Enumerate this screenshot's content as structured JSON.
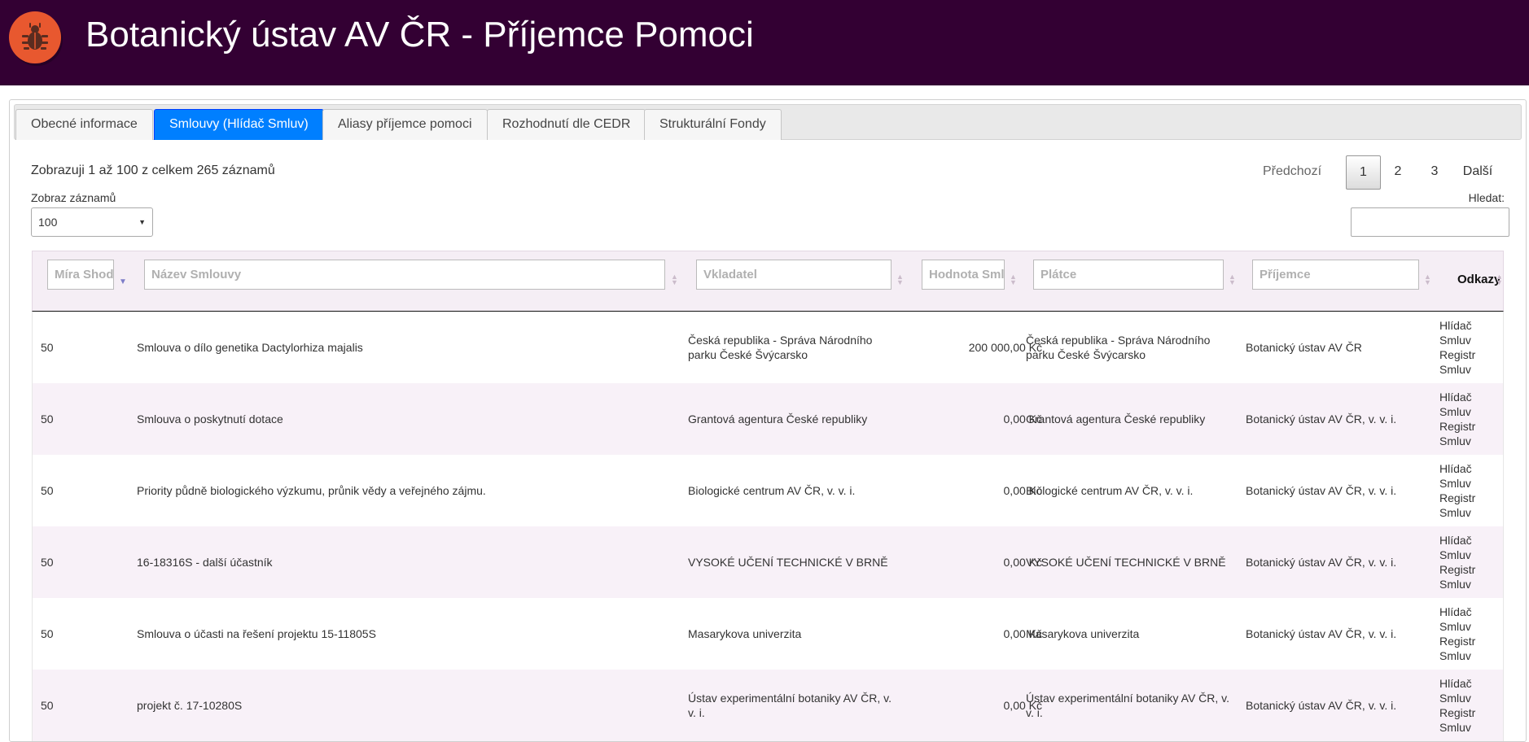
{
  "header": {
    "title": "Botanický ústav AV ČR - Příjemce Pomoci",
    "logo_icon": "bug-icon",
    "brand_color": "#330033",
    "logo_color": "#e8582f"
  },
  "tabs": [
    {
      "label": "Obecné informace",
      "active": false
    },
    {
      "label": "Smlouvy (Hlídač Smluv)",
      "active": true
    },
    {
      "label": "Aliasy příjemce pomoci",
      "active": false
    },
    {
      "label": "Rozhodnutí dle CEDR",
      "active": false
    },
    {
      "label": "Strukturální Fondy",
      "active": false
    }
  ],
  "table_info": "Zobrazuji 1 až 100 z celkem 265 záznamů",
  "length": {
    "label": "Zobraz záznamů",
    "value": "100"
  },
  "pagination": {
    "prev": "Předchozí",
    "pages": [
      "1",
      "2",
      "3"
    ],
    "current": "1",
    "next": "Další"
  },
  "search": {
    "label": "Hledat:",
    "value": ""
  },
  "columns": {
    "mira": "Míra Shoda",
    "nazev": "Název Smlouvy",
    "vkladatel": "Vkladatel",
    "hodnota": "Hodnota Smlouvy",
    "platce": "Plátce",
    "prijemce": "Příjemce",
    "odkazy": "Odkazy"
  },
  "rows": [
    {
      "mira": "50",
      "nazev": "Smlouva o dílo genetika Dactylorhiza majalis",
      "vkladatel": "Česká republika - Správa Národního parku České Švýcarsko",
      "hodnota": "200 000,00 Kč",
      "platce": "Česká republika - Správa Národního parku České Švýcarsko",
      "prijemce": "Botanický ústav AV ČR",
      "links": [
        "Hlídač",
        "Smluv",
        "Registr",
        "Smluv"
      ]
    },
    {
      "mira": "50",
      "nazev": "Smlouva o poskytnutí dotace",
      "vkladatel": "Grantová agentura České republiky",
      "hodnota": "0,00 Kč",
      "platce": "Grantová agentura České republiky",
      "prijemce": "Botanický ústav AV ČR, v. v. i.",
      "links": [
        "Hlídač",
        "Smluv",
        "Registr",
        "Smluv"
      ]
    },
    {
      "mira": "50",
      "nazev": "Priority půdně biologického výzkumu, průnik vědy a veřejného zájmu.",
      "vkladatel": "Biologické centrum AV ČR, v. v. i.",
      "hodnota": "0,00 Kč",
      "platce": "Biologické centrum AV ČR, v. v. i.",
      "prijemce": "Botanický ústav AV ČR, v. v. i.",
      "links": [
        "Hlídač",
        "Smluv",
        "Registr",
        "Smluv"
      ]
    },
    {
      "mira": "50",
      "nazev": "16-18316S - další účastník",
      "vkladatel": "VYSOKÉ UČENÍ TECHNICKÉ V BRNĚ",
      "hodnota": "0,00 Kč",
      "platce": "VYSOKÉ UČENÍ TECHNICKÉ V BRNĚ",
      "prijemce": "Botanický ústav AV ČR, v. v. i.",
      "links": [
        "Hlídač",
        "Smluv",
        "Registr",
        "Smluv"
      ]
    },
    {
      "mira": "50",
      "nazev": "Smlouva o účasti na řešení projektu 15-11805S",
      "vkladatel": "Masarykova univerzita",
      "hodnota": "0,00 Kč",
      "platce": "Masarykova univerzita",
      "prijemce": "Botanický ústav AV ČR, v. v. i.",
      "links": [
        "Hlídač",
        "Smluv",
        "Registr",
        "Smluv"
      ]
    },
    {
      "mira": "50",
      "nazev": "projekt č. 17-10280S",
      "vkladatel": "Ústav experimentální botaniky AV ČR, v. v. i.",
      "hodnota": "0,00 Kč",
      "platce": "Ústav experimentální botaniky AV ČR, v. v. i.",
      "prijemce": "Botanický ústav AV ČR, v. v. i.",
      "links": [
        "Hlídač",
        "Smluv",
        "Registr",
        "Smluv"
      ]
    }
  ]
}
